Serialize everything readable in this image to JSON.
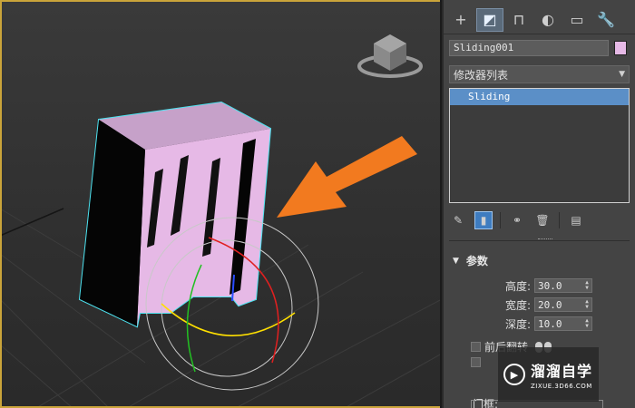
{
  "command_panel": {
    "tabs": [
      {
        "icon": "plus-icon",
        "glyph": "+"
      },
      {
        "icon": "modify-icon",
        "glyph": "◩"
      },
      {
        "icon": "hierarchy-icon",
        "glyph": "⊓"
      },
      {
        "icon": "motion-icon",
        "glyph": "◐"
      },
      {
        "icon": "display-icon",
        "glyph": "▭"
      },
      {
        "icon": "utilities-icon",
        "glyph": "🔧"
      }
    ],
    "object_name": "Sliding001",
    "object_color": "#e6b9e6",
    "modifier_list": "修改器列表",
    "stack_items": [
      "Sliding"
    ],
    "parameters": {
      "title": "参数",
      "height_label": "高度:",
      "height_value": "30.0",
      "width_label": "宽度:",
      "width_value": "20.0",
      "depth_label": "深度:",
      "depth_value": "10.0",
      "flip_label": "前后翻转",
      "door_frame_label": "门框:"
    }
  },
  "viewport": {
    "border_color": "#caa43a",
    "object_color": "#e6b9e6",
    "selection_color": "#4de3f0",
    "arrow_color": "#f27a1f"
  },
  "watermark": {
    "title": "溜溜自学",
    "url": "ZIXUE.3D66.COM"
  }
}
